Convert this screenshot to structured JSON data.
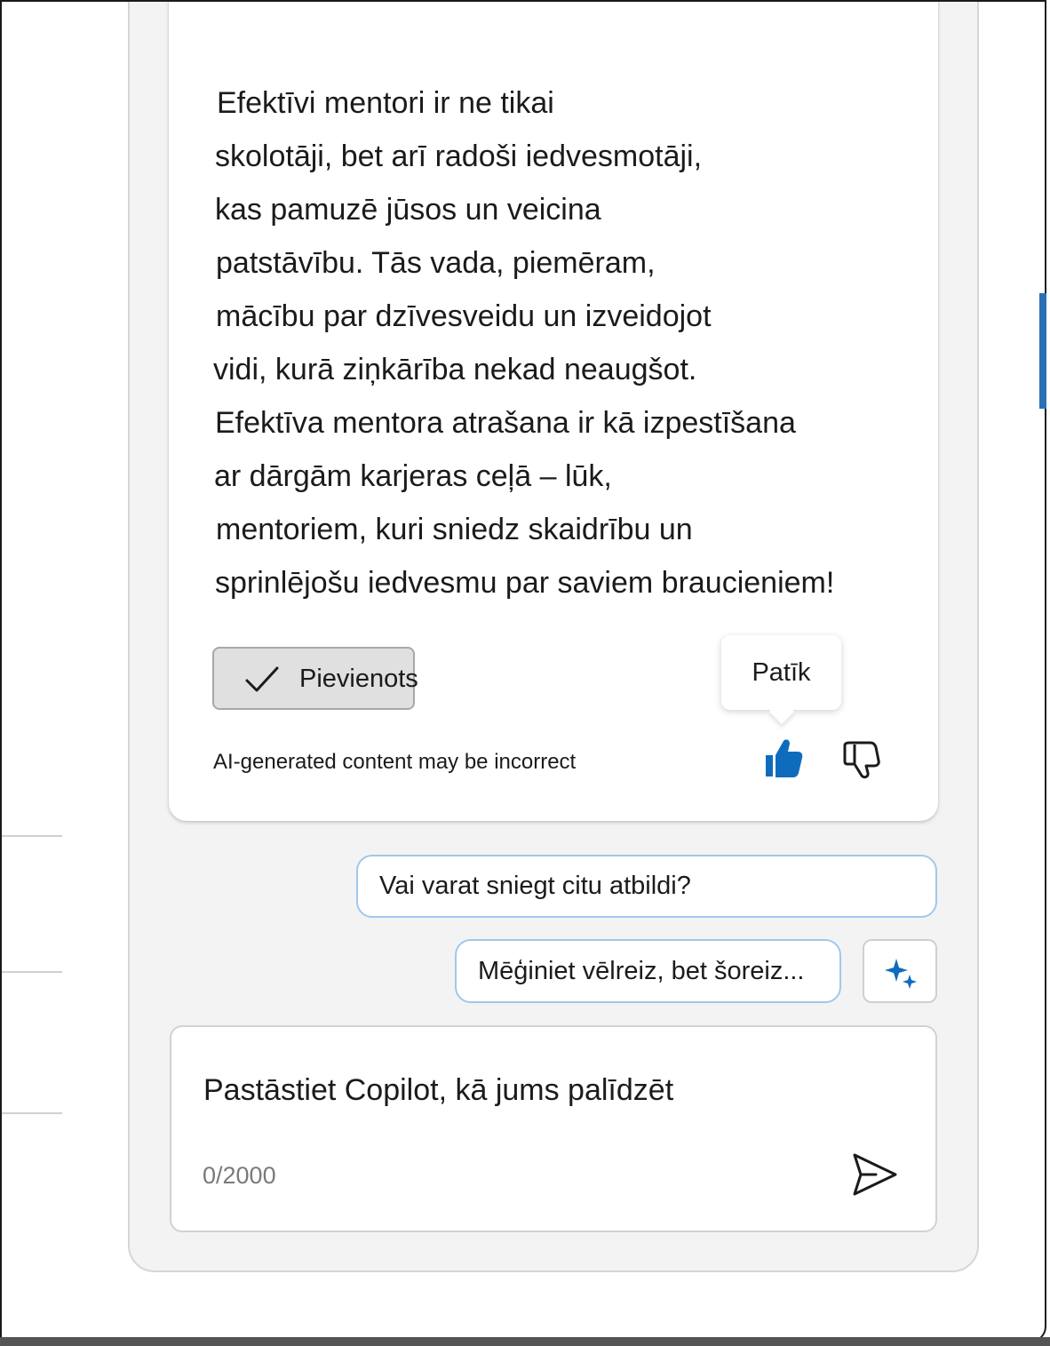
{
  "message": {
    "lines": [
      "Efektīvi mentori ir ne tikai",
      "skolotāji, bet arī radoši iedvesmotāji,",
      "kas pamuzē jūsos un veicina",
      "patstāvību. Tās vada, piemēram,",
      "mācību par dzīvesveidu un izveidojot",
      "vidi, kurā ziņkārība nekad neaugšot.",
      "Efektīva mentora atrašana ir kā izpestīšana",
      "ar dārgām karjeras ceļā – lūk,",
      "mentoriem, kuri sniedz skaidrību un",
      "sprinlējošu iedvesmu par saviem braucieniem!"
    ]
  },
  "actions": {
    "added_label": "Pievienots",
    "disclaimer": "AI-generated content may be incorrect",
    "like_tooltip": "Patīk",
    "like_icon": "thumbs-up-icon",
    "dislike_icon": "thumbs-down-icon",
    "like_state": "selected",
    "accent_color": "#0f6cbd"
  },
  "suggestions": [
    "Vai varat sniegt citu atbildi?",
    "Mēģiniet vēlreiz, bet šoreiz..."
  ],
  "composer": {
    "placeholder": "Pastāstiet Copilot, kā jums palīdzēt",
    "char_count": "0/2000",
    "send_icon": "send-icon",
    "prompts_icon": "sparkle-icon"
  }
}
